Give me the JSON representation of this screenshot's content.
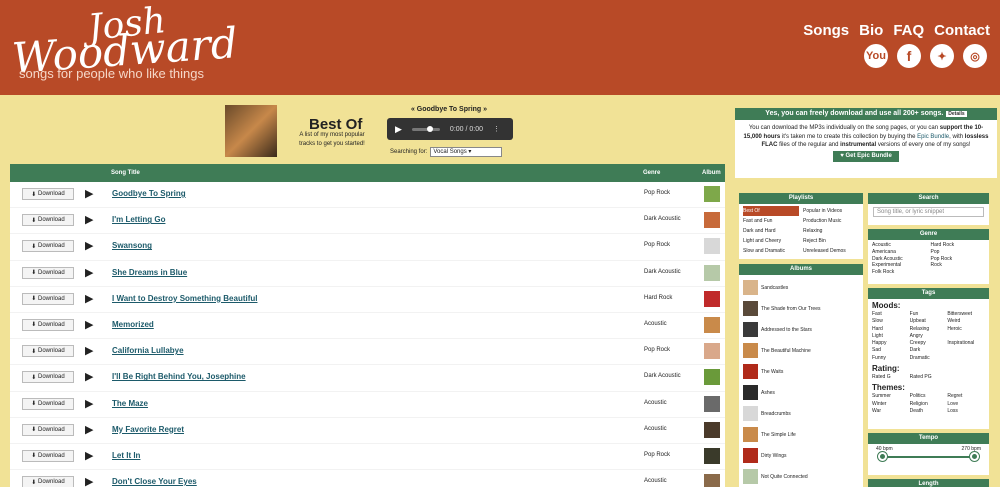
{
  "header": {
    "logo_line1": "Josh",
    "logo_line2": "Woodward",
    "tagline": "songs for people who like things",
    "nav": [
      "Songs",
      "Bio",
      "FAQ",
      "Contact"
    ],
    "social_icons": [
      "youtube-icon",
      "facebook-icon",
      "twitter-icon",
      "instagram-icon"
    ]
  },
  "playlist": {
    "title": "Best Of",
    "description": "A list of my most popular tracks to get you started!",
    "now_playing": "« Goodbye To Spring »",
    "time": "0:00 / 0:00",
    "search_label": "Searching for:",
    "search_value": "Vocal Songs"
  },
  "table": {
    "col_song": "Song Title",
    "col_genre": "Genre",
    "col_album": "Album",
    "download_label": "Download",
    "rows": [
      {
        "title": "Goodbye To Spring",
        "genre": "Pop Rock",
        "color": "#7ea84a"
      },
      {
        "title": "I'm Letting Go",
        "genre": "Dark Acoustic",
        "color": "#c76a3a"
      },
      {
        "title": "Swansong",
        "genre": "Pop Rock",
        "color": "#d8d8d8"
      },
      {
        "title": "She Dreams in Blue",
        "genre": "Dark Acoustic",
        "color": "#b6c9a8"
      },
      {
        "title": "I Want to Destroy Something Beautiful",
        "genre": "Hard Rock",
        "color": "#c02a2a"
      },
      {
        "title": "Memorized",
        "genre": "Acoustic",
        "color": "#c98a4a"
      },
      {
        "title": "California Lullabye",
        "genre": "Pop Rock",
        "color": "#d9a88a"
      },
      {
        "title": "I'll Be Right Behind You, Josephine",
        "genre": "Dark Acoustic",
        "color": "#6a9a3a"
      },
      {
        "title": "The Maze",
        "genre": "Acoustic",
        "color": "#6a6a6a"
      },
      {
        "title": "My Favorite Regret",
        "genre": "Acoustic",
        "color": "#4a3a2a"
      },
      {
        "title": "Let It In",
        "genre": "Pop Rock",
        "color": "#3a3a2a"
      },
      {
        "title": "Don't Close Your Eyes",
        "genre": "Acoustic",
        "color": "#8a6a4a"
      }
    ]
  },
  "info": {
    "heading": "Yes, you can freely download and use all 200+ songs.",
    "details": "Details",
    "text1": "You can download the MP3s individually on the song pages, or you can ",
    "bold1": "support the 10-15,000 hours",
    "text2": " it's taken me to create this collection by buying the ",
    "link": "Epic Bundle",
    "text3": ", with ",
    "bold2": "lossless FLAC",
    "text4": " files of the regular and ",
    "bold3": "instrumental",
    "text5": " versions of every one of my songs!",
    "button": "Get Epic Bundle"
  },
  "playlists": {
    "heading": "Playlists",
    "items": [
      "Best Of",
      "Popular in Videos",
      "Fast and Fun",
      "Production Music",
      "Dark and Hard",
      "Relaxing",
      "Light and Cheery",
      "Reject Bin",
      "Slow and Dramatic",
      "Unreleased Demos"
    ]
  },
  "albums": {
    "heading": "Albums",
    "items": [
      {
        "name": "Sandcastles",
        "color": "#d9b48a"
      },
      {
        "name": "The Shade from Our Trees",
        "color": "#5a4a3a"
      },
      {
        "name": "Addressed to the Stars",
        "color": "#3a3a3a"
      },
      {
        "name": "The Beautiful Machine",
        "color": "#c98a4a"
      },
      {
        "name": "The Waits",
        "color": "#b02a1a"
      },
      {
        "name": "Ashes",
        "color": "#2a2a2a"
      },
      {
        "name": "Breadcrumbs",
        "color": "#d8d8d8"
      },
      {
        "name": "The Simple Life",
        "color": "#c98a4a"
      },
      {
        "name": "Dirty Wings",
        "color": "#b02a1a"
      },
      {
        "name": "Not Quite Connected",
        "color": "#b6c9a8"
      }
    ]
  },
  "search": {
    "heading": "Search",
    "placeholder": "Song title, or lyric snippet"
  },
  "genre": {
    "heading": "Genre",
    "items": [
      "Acoustic",
      "Hard Rock",
      "Americana",
      "Pop",
      "Dark Acoustic",
      "Pop Rock",
      "Experimental",
      "Rock",
      "Folk Rock",
      ""
    ]
  },
  "tags": {
    "heading": "Tags",
    "moods_label": "Moods:",
    "moods": [
      "Fast",
      "Fun",
      "Bittersweet",
      "Slow",
      "Upbeat",
      "Weird",
      "Hard",
      "Relaxing",
      "Heroic",
      "Light",
      "Angry",
      "",
      "Happy",
      "Creepy",
      "Inspirational",
      "Sad",
      "Dark",
      "",
      "Funny",
      "Dramatic",
      ""
    ],
    "rating_label": "Rating:",
    "rating": [
      "Rated G",
      "Rated PG",
      ""
    ],
    "themes_label": "Themes:",
    "themes": [
      "Summer",
      "Politics",
      "Regret",
      "Winter",
      "Religion",
      "Love",
      "War",
      "Death",
      "Loss"
    ]
  },
  "tempo": {
    "heading": "Tempo",
    "min": "40 bpm",
    "max": "270 bpm",
    "low": 40,
    "high": 270
  },
  "length": {
    "heading": "Length"
  }
}
